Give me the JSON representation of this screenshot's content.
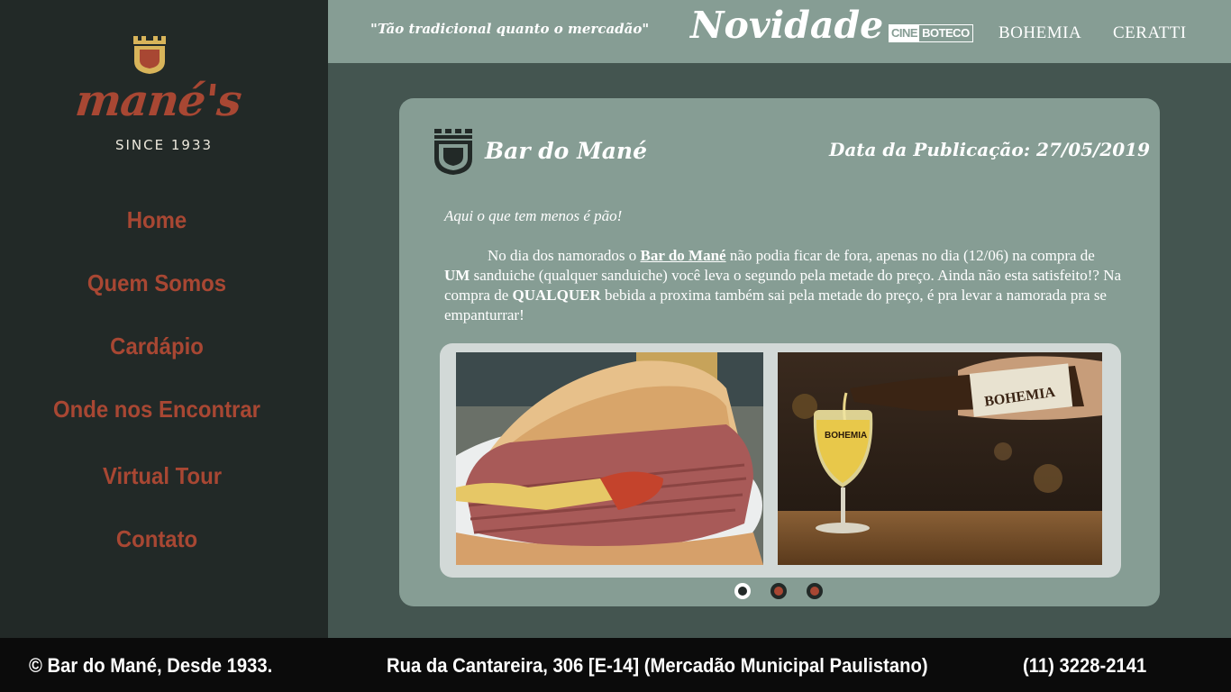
{
  "brand": {
    "name": "mané's",
    "since": "SINCE 1933",
    "colors": {
      "accent": "#a84733",
      "gold": "#d8b45a",
      "sidebar": "#222927",
      "topbar": "#869d94",
      "background": "#445550"
    }
  },
  "nav": {
    "items": [
      {
        "label": "Home"
      },
      {
        "label": "Quem Somos"
      },
      {
        "label": "Cardápio"
      },
      {
        "label": "Onde nos Encontrar"
      },
      {
        "label": "Virtual Tour"
      },
      {
        "label": "Contato"
      }
    ]
  },
  "topbar": {
    "slogan": "\"Tão tradicional quanto o mercadão\"",
    "section_title": "Novidade",
    "partners": {
      "cineboteco": {
        "cine": "CINE",
        "boteco": "BOTECO"
      },
      "bohemia": "BOHEMIA",
      "ceratti": "CERATTI"
    }
  },
  "post": {
    "title": "Bar do Mané",
    "date_label": "Data da Publicação: 27/05/2019",
    "intro": "Aqui o que tem menos é pão!",
    "body": {
      "p1": "No dia dos namorados o ",
      "link": "Bar do Mané",
      "p2": " não podia ficar de fora, apenas no dia (12/06) na compra de ",
      "b1": "UM",
      "p3": " sanduiche (qualquer sanduiche) você leva o segundo pela metade do preço. Ainda não esta satisfeito!? Na compra de ",
      "b2": "QUALQUER",
      "p4": " bebida a proxima também sai pela metade do preço, é pra levar a namorada pra se empanturrar!"
    },
    "gallery": {
      "images": [
        {
          "icon": "mortadella-sandwich-photo"
        },
        {
          "icon": "beer-pour-photo",
          "label": "BOHEMIA"
        }
      ],
      "slide_count": 3,
      "active_slide": 1
    }
  },
  "footer": {
    "copyright": "© Bar do Mané, Desde 1933.",
    "address": "Rua da Cantareira, 306 [E-14] (Mercadão Municipal Paulistano)",
    "phone": "(11) 3228-2141"
  }
}
